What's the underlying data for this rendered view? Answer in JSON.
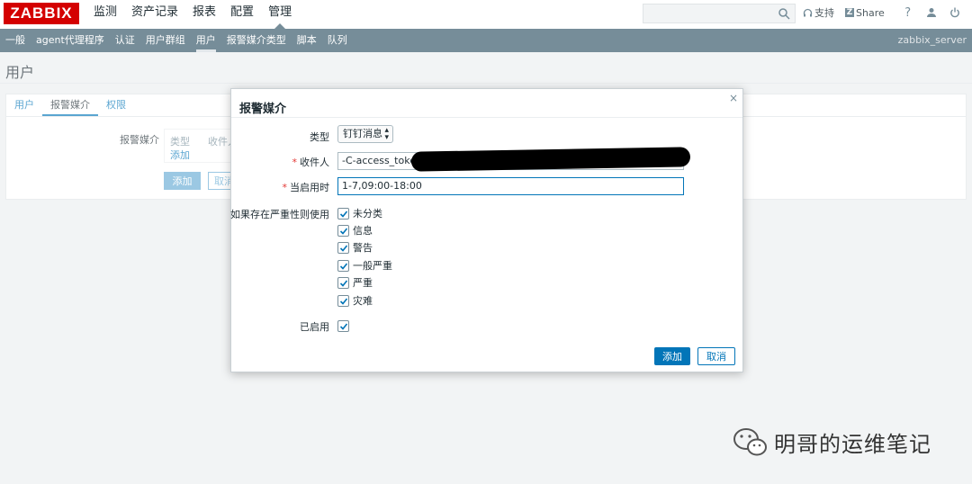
{
  "header": {
    "logo": "ZABBIX",
    "menu": [
      "监测",
      "资产记录",
      "报表",
      "配置",
      "管理"
    ],
    "active_menu": "管理",
    "search": {
      "value": "",
      "placeholder": ""
    },
    "links": {
      "support": "支持",
      "share": "Share",
      "share_box": "Z",
      "help": "?"
    }
  },
  "submenu": {
    "items": [
      "一般",
      "agent代理程序",
      "认证",
      "用户群组",
      "用户",
      "报警媒介类型",
      "脚本",
      "队列"
    ],
    "active": "用户",
    "server": "zabbix_server"
  },
  "page": {
    "title": "用户",
    "tabs": [
      "用户",
      "报警媒介",
      "权限"
    ],
    "active_tab": "报警媒介",
    "media_label": "报警媒介",
    "media_col_type": "类型",
    "media_col_recipient": "收件人",
    "media_add_link": "添加",
    "add_button": "添加",
    "cancel_button": "取消"
  },
  "dialog": {
    "title": "报警媒介",
    "close": "×",
    "type_label": "类型",
    "type_value": "钉钉消息",
    "recipient_label": "收件人",
    "recipient_value": "-C-access_token=",
    "when_active_label": "当启用时",
    "when_active_value": "1-7,09:00-18:00",
    "severity_label": "如果存在严重性则使用",
    "severities": [
      {
        "label": "未分类",
        "checked": true
      },
      {
        "label": "信息",
        "checked": true
      },
      {
        "label": "警告",
        "checked": true
      },
      {
        "label": "一般严重",
        "checked": true
      },
      {
        "label": "严重",
        "checked": true
      },
      {
        "label": "灾难",
        "checked": true
      }
    ],
    "enabled_label": "已启用",
    "enabled": true,
    "add_button": "添加",
    "cancel_button": "取消"
  },
  "watermark": {
    "text": "明哥的运维笔记"
  },
  "colors": {
    "brand": "#d40000",
    "submenu_bg": "#768d99",
    "accent": "#0275b8",
    "required": "#e33734"
  }
}
